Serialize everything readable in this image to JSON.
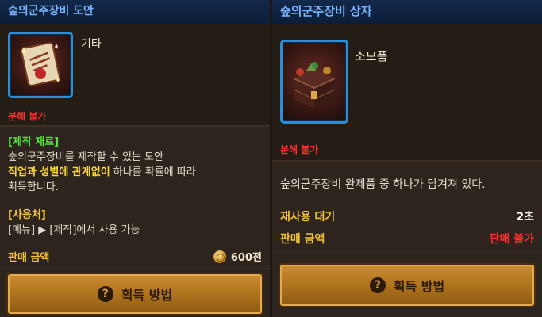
{
  "left": {
    "title": "숲의군주장비 도안",
    "category": "기타",
    "disassemble": "분해 불가",
    "craft_title": "[제작 재료]",
    "desc_line1": "숲의군주장비를 제작할 수 있는 도안",
    "desc_line2_hl1": "직업과 성별에 관계없이",
    "desc_line2_rest": " 하나를 확률에 따라",
    "desc_line3": "획득합니다.",
    "use_title": "[사용처]",
    "use_menu": "[메뉴]",
    "use_arrow": "▶",
    "use_rest": " [제작]에서 사용 가능",
    "sell_label": "판매 금액",
    "sell_value": "600전",
    "button_label": "획득 방법",
    "button_icon": "?"
  },
  "right": {
    "title": "숲의군주장비 상자",
    "category": "소모품",
    "disassemble": "분해 불가",
    "desc": "숲의군주장비 완제품 중 하나가 담겨져 있다.",
    "reuse_label": "재사용 대기",
    "reuse_value": "2초",
    "sell_label": "판매 금액",
    "sell_value": "판매 불가",
    "button_label": "획득 방법",
    "button_icon": "?"
  },
  "icons": {
    "left_item": "recipe-scroll-icon",
    "right_item": "treasure-chest-icon",
    "coin": "coin-icon",
    "help": "question-mark-icon"
  },
  "colors": {
    "title": "#79b4ff",
    "disassemble": "#ff2d2d",
    "label": "#f2c23a",
    "green_tag": "#55e23a",
    "icon_border": "#2c8dd8",
    "button": "#b2761f"
  }
}
